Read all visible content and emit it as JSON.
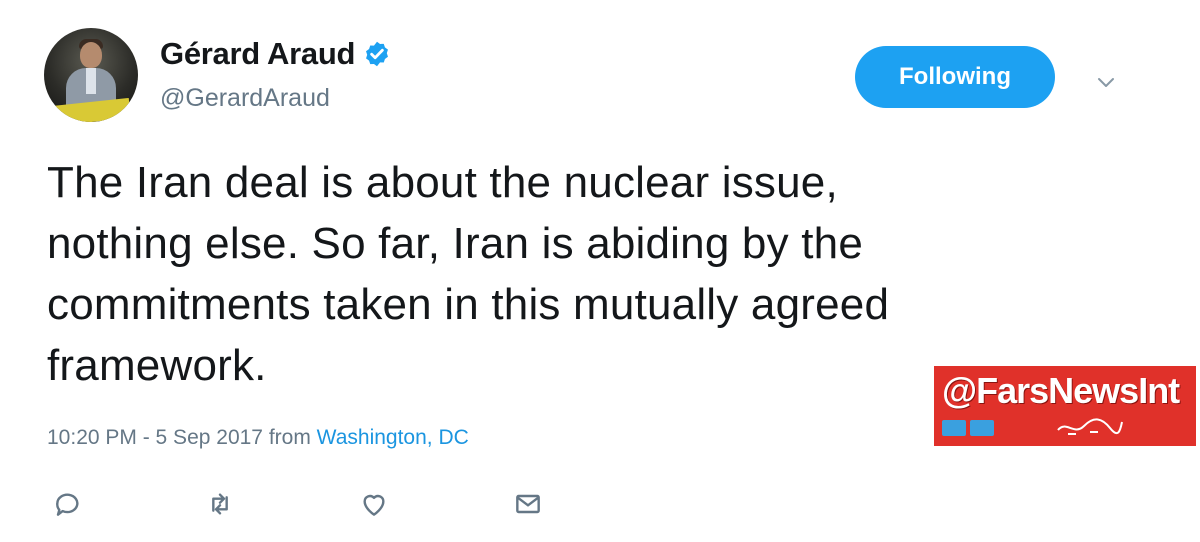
{
  "author": {
    "name": "Gérard Araud",
    "handle": "@GerardAraud",
    "verified": true
  },
  "follow_button": {
    "label": "Following"
  },
  "tweet": {
    "lines": [
      "The Iran deal is about the nuclear issue,",
      "nothing else. So far, Iran is abiding by the",
      "commitments taken in this mutually agreed",
      "framework."
    ]
  },
  "meta": {
    "timestamp": "10:20 PM - 5 Sep 2017",
    "from_label": "from",
    "location": "Washington, DC"
  },
  "watermark": {
    "text": "@FarsNewsInt"
  },
  "actions": [
    "reply-icon",
    "retweet-icon",
    "like-icon",
    "message-icon"
  ],
  "colors": {
    "accent": "#1da1f2",
    "link": "#1b95e0",
    "secondary_text": "#657786",
    "watermark_bg": "#e0312a"
  }
}
